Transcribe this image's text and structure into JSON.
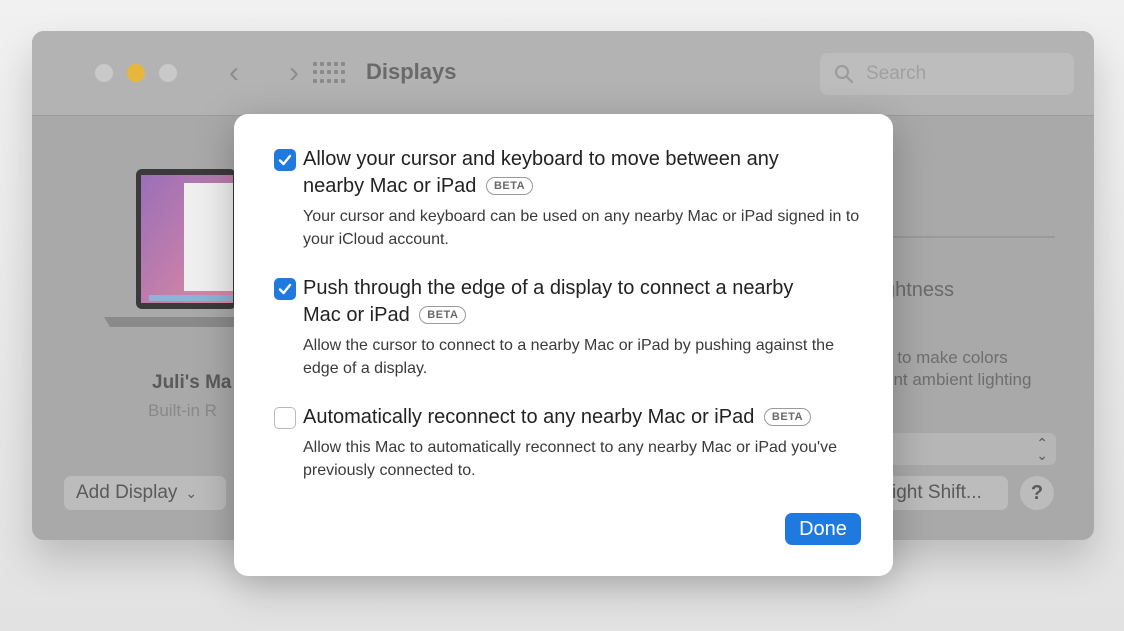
{
  "window": {
    "title": "Displays",
    "search_placeholder": "Search"
  },
  "display_list": {
    "name": "Juli's Ma",
    "subtitle": "Built-in R",
    "add_display_label": "Add Display"
  },
  "right_panel": {
    "brightness_label": "ghtness",
    "desc_line1": "y to make colors",
    "desc_line2": "ent ambient lighting",
    "night_shift_label": "ight Shift...",
    "help_label": "?"
  },
  "sheet": {
    "beta_badge": "BETA",
    "options": [
      {
        "title_line1": "Allow your cursor and keyboard to move between any",
        "title_line2": "nearby Mac or iPad",
        "description": "Your cursor and keyboard can be used on any nearby Mac or iPad signed in to your iCloud account.",
        "checked": true
      },
      {
        "title_line1": "Push through the edge of a display to connect a nearby",
        "title_line2": "Mac or iPad",
        "description": "Allow the cursor to connect to a nearby Mac or iPad by pushing against the edge of a display.",
        "checked": true
      },
      {
        "title_line1": "Automatically reconnect to any nearby Mac or iPad",
        "title_line2": "",
        "description": "Allow this Mac to automatically reconnect to any nearby Mac or iPad you've previously connected to.",
        "checked": false
      }
    ],
    "done_label": "Done"
  },
  "colors": {
    "accent": "#1f7ae0",
    "minimize": "#e7b63d"
  }
}
